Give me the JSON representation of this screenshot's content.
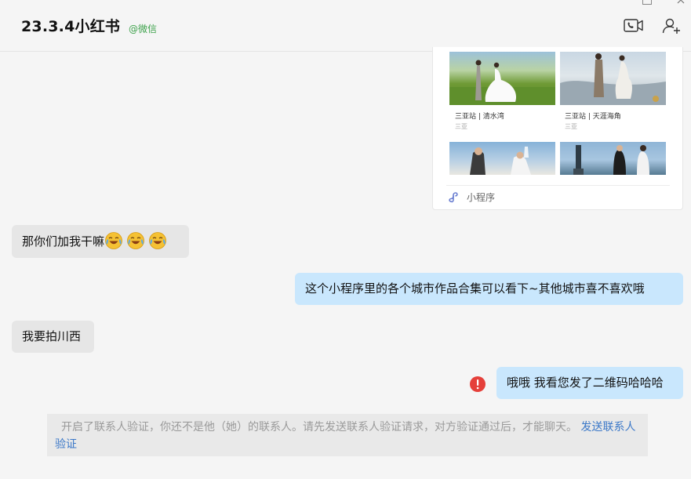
{
  "header": {
    "title": "23.3.4小红书",
    "source": "@微信"
  },
  "mini_program_card": {
    "items": [
      {
        "caption": "三亚站 | 清水湾",
        "sub": "三亚"
      },
      {
        "caption": "三亚站 | 天涯海角",
        "sub": "三亚"
      }
    ],
    "footer_label": "小程序"
  },
  "messages": [
    {
      "side": "in",
      "text": "那你们加我干嘛",
      "emoji": [
        "laugh-cry-emoji",
        "laugh-cry-emoji",
        "laugh-cry-emoji"
      ]
    },
    {
      "side": "out",
      "text": "这个小程序里的各个城市作品合集可以看下~其他城市喜不喜欢哦"
    },
    {
      "side": "in",
      "text": "我要拍川西"
    },
    {
      "side": "out",
      "text": "哦哦 我看您发了二维码哈哈哈",
      "status": "failed"
    }
  ],
  "notice": {
    "text": "开启了联系人验证，你还不是他（她）的联系人。请先发送联系人验证请求，对方验证通过后，才能聊天。",
    "link": "发送联系人验证"
  },
  "colors": {
    "incoming_bubble": "#e6e6e6",
    "outgoing_bubble": "#c9e7fd",
    "link": "#3b78c8",
    "source": "#3fa34d",
    "error": "#e5403a"
  }
}
